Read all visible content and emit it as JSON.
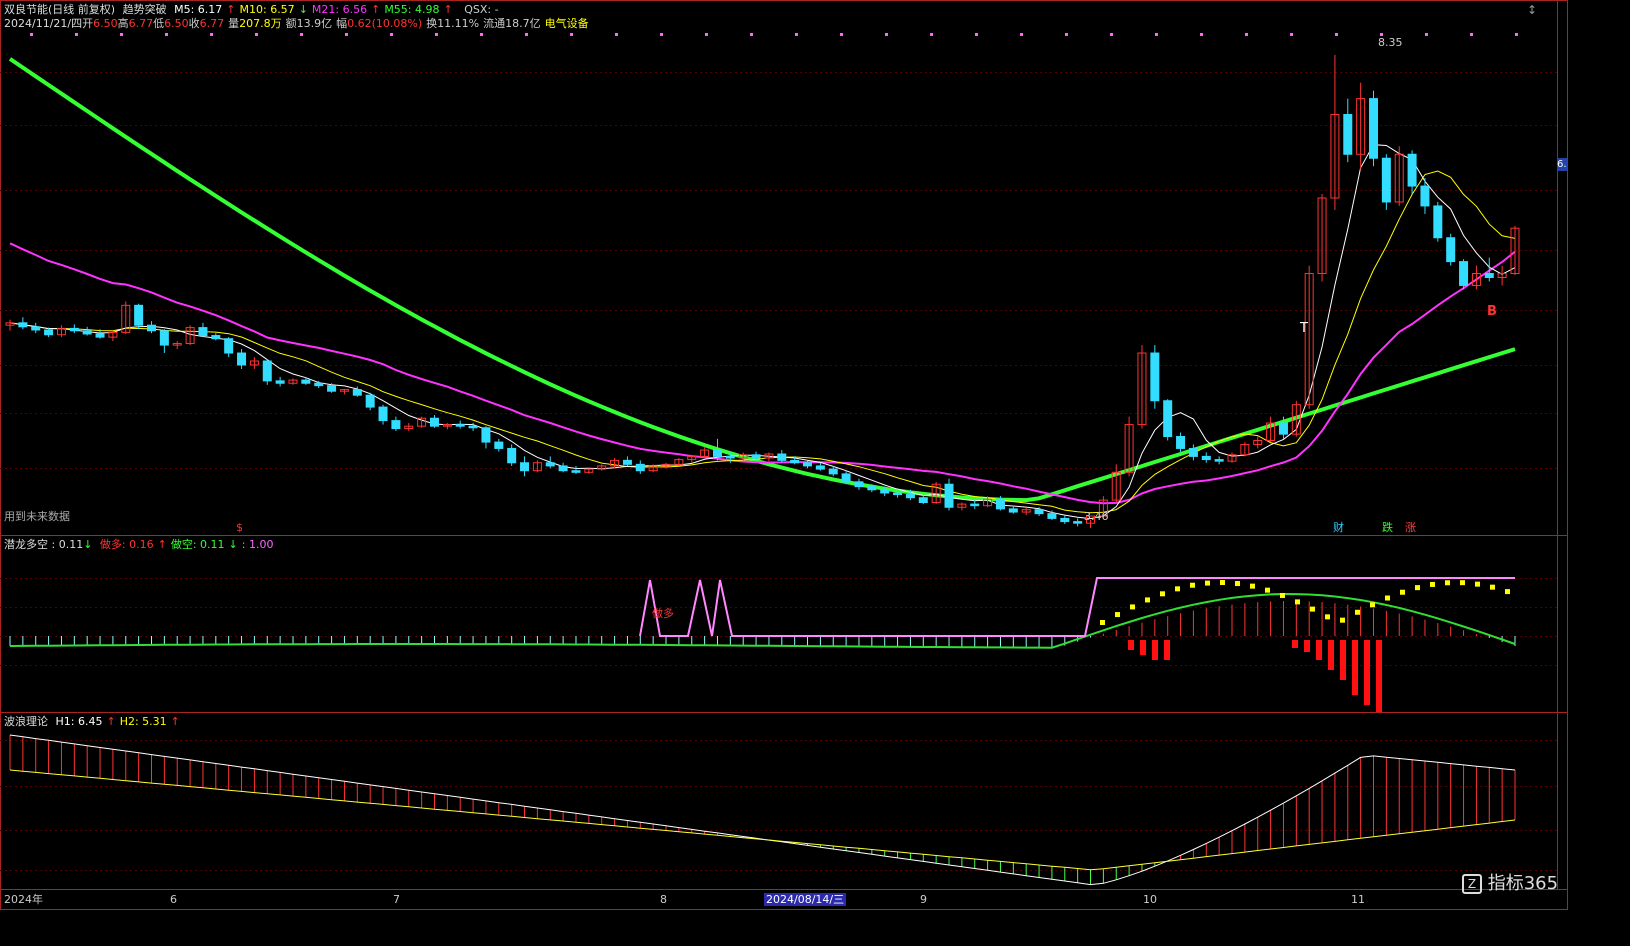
{
  "header": {
    "stock_name": "双良节能(日线 前复权)",
    "indicator": "趋势突破",
    "ma": [
      {
        "label": "M5: 6.17",
        "arrow": "↑",
        "color": "#ffffff"
      },
      {
        "label": "M10: 6.57",
        "arrow": "↓",
        "color": "#ffff00"
      },
      {
        "label": "M21: 6.56",
        "arrow": "↑",
        "color": "#ff33ff"
      },
      {
        "label": "M55: 4.98",
        "arrow": "↑",
        "color": "#33ff33"
      }
    ],
    "qsx": "QSX: -",
    "date": "2024/11/21/四",
    "open_label": "开",
    "open": "6.50",
    "high_label": "高",
    "high": "6.77",
    "low_label": "低",
    "low": "6.50",
    "close_label": "收",
    "close": "6.77",
    "vol_label": "量",
    "vol": "207.8万",
    "amt_label": "额",
    "amt": "13.9亿",
    "chg_label": "幅",
    "chg": "0.62(10.08%)",
    "turn_label": "换",
    "turn": "11.11%",
    "float_label": "流通",
    "float": "18.7亿",
    "sector": "电气设备",
    "close_icon": "↕"
  },
  "annotations": {
    "high_label": "8.35",
    "low_label": "3.46",
    "future_data": "用到未来数据",
    "dollar_mark": "$",
    "b_signal": "B",
    "t_signal": "T",
    "tags": [
      {
        "text": "财",
        "color": "#33ccff"
      },
      {
        "text": "跌",
        "color": "#33ff33"
      },
      {
        "text": "涨",
        "color": "#ff4444"
      }
    ],
    "right_price": "6.",
    "zuoduo_text": "做多"
  },
  "panel2": {
    "title": "潜龙多空",
    "value": ": 0.11",
    "arrow": "↓",
    "items": [
      {
        "label": "做多: 0.16",
        "arrow": "↑",
        "color": "#ff3333"
      },
      {
        "label": "做空: 0.11",
        "arrow": "↓",
        "color": "#33ff33"
      },
      {
        "label": ": 1.00",
        "arrow": "",
        "color": "#ff66ff"
      }
    ]
  },
  "panel3": {
    "title": "波浪理论",
    "items": [
      {
        "label": "H1: 6.45",
        "arrow": "↑",
        "color": "#ffffff"
      },
      {
        "label": "H2: 5.31",
        "arrow": "↑",
        "color": "#ffff00"
      }
    ]
  },
  "xaxis": {
    "labels": [
      "2024年",
      "6",
      "7",
      "8",
      "2024/08/14/三",
      "9",
      "10",
      "11"
    ],
    "logo": "指标365"
  },
  "chart_data": {
    "type": "candlestick",
    "ylim": [
      3.2,
      8.8
    ],
    "ohlc": [
      [
        4.95,
        5.02,
        4.88,
        4.98
      ],
      [
        4.98,
        5.05,
        4.9,
        4.93
      ],
      [
        4.93,
        4.98,
        4.85,
        4.89
      ],
      [
        4.89,
        4.92,
        4.8,
        4.83
      ],
      [
        4.83,
        4.95,
        4.8,
        4.91
      ],
      [
        4.91,
        4.96,
        4.85,
        4.88
      ],
      [
        4.88,
        4.93,
        4.82,
        4.84
      ],
      [
        4.84,
        4.9,
        4.78,
        4.8
      ],
      [
        4.8,
        4.88,
        4.75,
        4.86
      ],
      [
        4.86,
        5.25,
        4.84,
        5.2
      ],
      [
        5.2,
        5.22,
        4.9,
        4.95
      ],
      [
        4.95,
        5.0,
        4.85,
        4.88
      ],
      [
        4.88,
        4.9,
        4.6,
        4.7
      ],
      [
        4.7,
        4.75,
        4.65,
        4.72
      ],
      [
        4.72,
        4.95,
        4.7,
        4.92
      ],
      [
        4.92,
        4.98,
        4.8,
        4.82
      ],
      [
        4.82,
        4.85,
        4.76,
        4.78
      ],
      [
        4.78,
        4.8,
        4.55,
        4.6
      ],
      [
        4.6,
        4.65,
        4.4,
        4.45
      ],
      [
        4.45,
        4.55,
        4.4,
        4.5
      ],
      [
        4.5,
        4.52,
        4.2,
        4.25
      ],
      [
        4.25,
        4.3,
        4.18,
        4.22
      ],
      [
        4.22,
        4.28,
        4.2,
        4.26
      ],
      [
        4.26,
        4.3,
        4.2,
        4.22
      ],
      [
        4.22,
        4.25,
        4.16,
        4.19
      ],
      [
        4.19,
        4.22,
        4.1,
        4.12
      ],
      [
        4.12,
        4.15,
        4.08,
        4.14
      ],
      [
        4.14,
        4.18,
        4.05,
        4.07
      ],
      [
        4.07,
        4.1,
        3.88,
        3.92
      ],
      [
        3.92,
        3.95,
        3.7,
        3.75
      ],
      [
        3.75,
        3.8,
        3.62,
        3.65
      ],
      [
        3.65,
        3.72,
        3.62,
        3.68
      ],
      [
        3.68,
        3.8,
        3.66,
        3.78
      ],
      [
        3.78,
        3.82,
        3.66,
        3.68
      ],
      [
        3.68,
        3.72,
        3.64,
        3.7
      ],
      [
        3.7,
        3.75,
        3.65,
        3.68
      ],
      [
        3.68,
        3.72,
        3.62,
        3.66
      ],
      [
        3.66,
        3.68,
        3.4,
        3.48
      ],
      [
        3.48,
        3.52,
        3.36,
        3.4
      ],
      [
        3.4,
        3.45,
        3.18,
        3.22
      ],
      [
        3.22,
        3.3,
        3.05,
        3.12
      ],
      [
        3.12,
        3.25,
        3.1,
        3.22
      ],
      [
        3.22,
        3.3,
        3.15,
        3.18
      ],
      [
        3.18,
        3.22,
        3.1,
        3.12
      ],
      [
        3.12,
        3.18,
        3.08,
        3.1
      ],
      [
        3.1,
        3.15,
        3.08,
        3.14
      ],
      [
        3.14,
        3.2,
        3.12,
        3.18
      ],
      [
        3.18,
        3.28,
        3.15,
        3.25
      ],
      [
        3.25,
        3.3,
        3.18,
        3.2
      ],
      [
        3.2,
        3.25,
        3.08,
        3.12
      ],
      [
        3.12,
        3.2,
        3.1,
        3.18
      ],
      [
        3.18,
        3.22,
        3.15,
        3.2
      ],
      [
        3.2,
        3.28,
        3.18,
        3.26
      ],
      [
        3.26,
        3.32,
        3.22,
        3.3
      ],
      [
        3.3,
        3.42,
        3.28,
        3.38
      ],
      [
        3.38,
        3.52,
        3.25,
        3.3
      ],
      [
        3.3,
        3.35,
        3.22,
        3.28
      ],
      [
        3.28,
        3.35,
        3.25,
        3.32
      ],
      [
        3.32,
        3.36,
        3.25,
        3.28
      ],
      [
        3.28,
        3.35,
        3.24,
        3.33
      ],
      [
        3.33,
        3.38,
        3.22,
        3.25
      ],
      [
        3.25,
        3.3,
        3.2,
        3.22
      ],
      [
        3.22,
        3.25,
        3.15,
        3.18
      ],
      [
        3.18,
        3.22,
        3.12,
        3.14
      ],
      [
        3.14,
        3.18,
        3.05,
        3.08
      ],
      [
        3.08,
        3.12,
        2.95,
        2.98
      ],
      [
        2.98,
        3.02,
        2.88,
        2.92
      ],
      [
        2.92,
        2.95,
        2.85,
        2.88
      ],
      [
        2.88,
        2.92,
        2.8,
        2.84
      ],
      [
        2.84,
        2.9,
        2.78,
        2.82
      ],
      [
        2.82,
        2.88,
        2.75,
        2.78
      ],
      [
        2.78,
        2.82,
        2.7,
        2.72
      ],
      [
        2.72,
        2.98,
        2.7,
        2.95
      ],
      [
        2.95,
        3.02,
        2.62,
        2.66
      ],
      [
        2.66,
        2.72,
        2.62,
        2.7
      ],
      [
        2.7,
        2.75,
        2.64,
        2.68
      ],
      [
        2.68,
        2.8,
        2.66,
        2.76
      ],
      [
        2.76,
        2.8,
        2.62,
        2.64
      ],
      [
        2.64,
        2.68,
        2.58,
        2.6
      ],
      [
        2.6,
        2.66,
        2.56,
        2.63
      ],
      [
        2.63,
        2.66,
        2.55,
        2.58
      ],
      [
        2.58,
        2.62,
        2.5,
        2.52
      ],
      [
        2.52,
        2.56,
        2.45,
        2.48
      ],
      [
        2.48,
        2.52,
        2.42,
        2.46
      ],
      [
        2.46,
        2.5,
        2.4,
        2.55
      ],
      [
        2.55,
        2.8,
        2.52,
        2.75
      ],
      [
        2.75,
        3.2,
        2.72,
        3.1
      ],
      [
        3.1,
        3.8,
        3.05,
        3.7
      ],
      [
        3.7,
        4.7,
        3.65,
        4.6
      ],
      [
        4.6,
        4.7,
        3.9,
        4.0
      ],
      [
        4.0,
        4.02,
        3.5,
        3.55
      ],
      [
        3.55,
        3.6,
        3.35,
        3.4
      ],
      [
        3.4,
        3.45,
        3.25,
        3.3
      ],
      [
        3.3,
        3.35,
        3.22,
        3.26
      ],
      [
        3.26,
        3.3,
        3.2,
        3.24
      ],
      [
        3.24,
        3.35,
        3.22,
        3.32
      ],
      [
        3.32,
        3.48,
        3.3,
        3.45
      ],
      [
        3.45,
        3.55,
        3.4,
        3.5
      ],
      [
        3.5,
        3.8,
        3.48,
        3.72
      ],
      [
        3.72,
        3.8,
        3.52,
        3.58
      ],
      [
        3.58,
        4.0,
        3.55,
        3.95
      ],
      [
        3.95,
        5.7,
        3.9,
        5.6
      ],
      [
        5.6,
        6.6,
        5.5,
        6.55
      ],
      [
        6.55,
        8.35,
        6.4,
        7.6
      ],
      [
        7.6,
        7.8,
        7.0,
        7.1
      ],
      [
        7.1,
        8.0,
        6.9,
        7.8
      ],
      [
        7.8,
        7.9,
        6.95,
        7.05
      ],
      [
        7.05,
        7.1,
        6.4,
        6.5
      ],
      [
        6.5,
        7.2,
        6.45,
        7.1
      ],
      [
        7.1,
        7.15,
        6.6,
        6.7
      ],
      [
        6.7,
        6.8,
        6.35,
        6.45
      ],
      [
        6.45,
        6.5,
        6.0,
        6.05
      ],
      [
        6.05,
        6.1,
        5.7,
        5.75
      ],
      [
        5.75,
        5.78,
        5.4,
        5.45
      ],
      [
        5.45,
        5.7,
        5.4,
        5.6
      ],
      [
        5.6,
        5.8,
        5.5,
        5.55
      ],
      [
        5.55,
        5.7,
        5.45,
        5.6
      ],
      [
        5.6,
        6.2,
        5.58,
        6.17
      ]
    ]
  }
}
